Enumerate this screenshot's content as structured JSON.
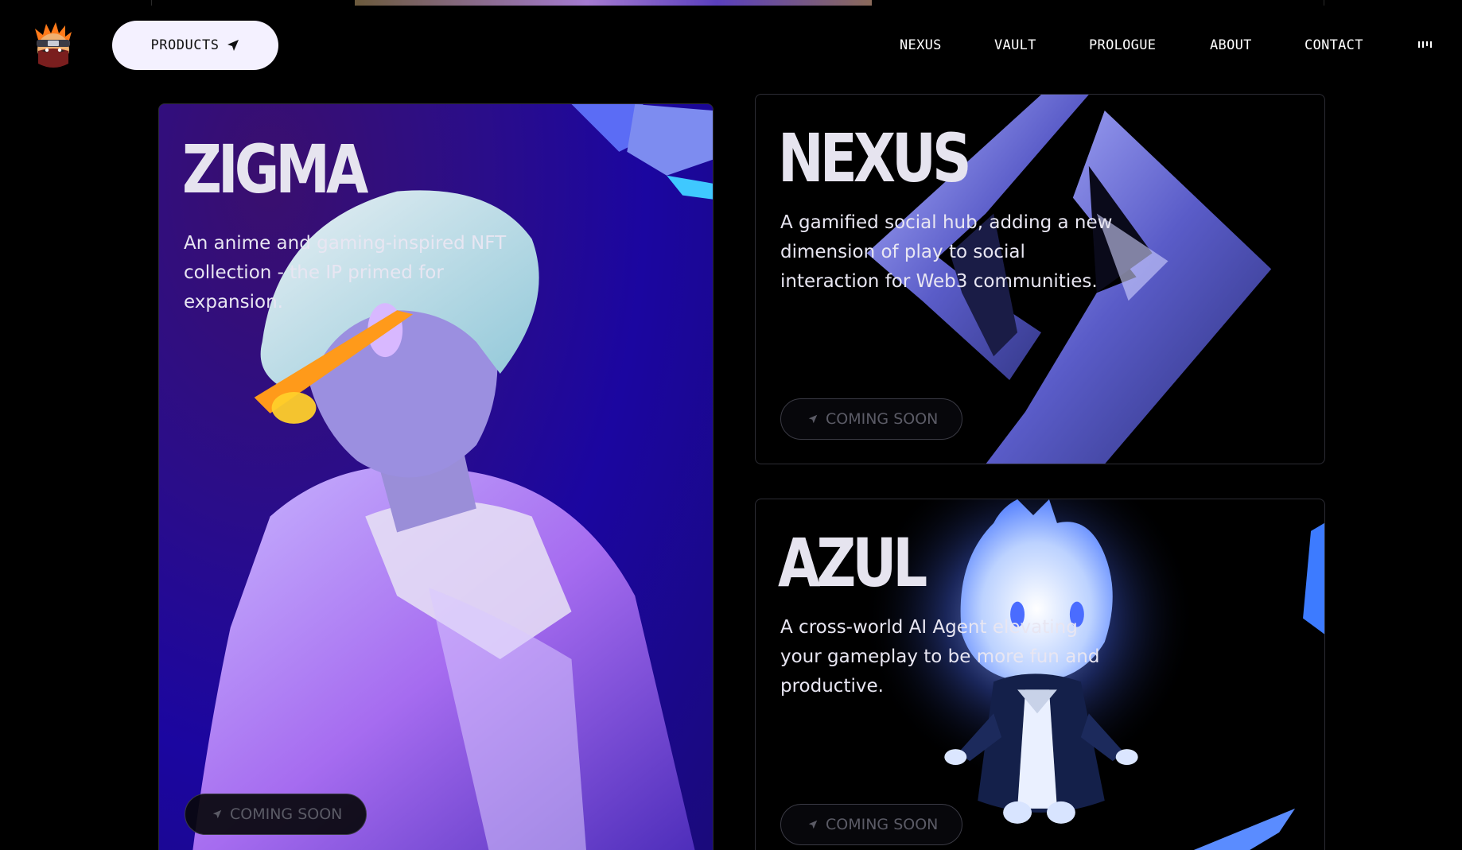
{
  "header": {
    "logo": "ninja-mascot-logo",
    "products_label": "PRODUCTS",
    "nav": [
      "NEXUS",
      "VAULT",
      "PROLOGUE",
      "ABOUT",
      "CONTACT"
    ],
    "sound_icon": "sound-bars-icon"
  },
  "cards": {
    "zigma": {
      "title": "ZIGMA",
      "description": "An anime and gaming-inspired NFT collection - the IP primed for expansion.",
      "desc_lines": [
        "An anime and gaming-inspired NFT",
        "collection - the IP primed for",
        "expansion."
      ],
      "button": "COMING SOON"
    },
    "nexus": {
      "title": "NEXUS",
      "desc_lines": [
        "A gamified social hub, adding a new",
        "dimension of play to social",
        "interaction for Web3 communities."
      ],
      "button": "COMING SOON"
    },
    "azul": {
      "title": "AZUL",
      "desc_lines": [
        "A cross-world AI Agent elevating",
        "your gameplay to be more fun and",
        "productive."
      ],
      "button": "COMING SOON"
    }
  },
  "colors": {
    "background": "#000000",
    "pill": "#f4f1ff",
    "zigma_bg": "#1b06a0",
    "accent_purple": "#7a6cf0",
    "azul_glow": "#9ab8ff"
  }
}
